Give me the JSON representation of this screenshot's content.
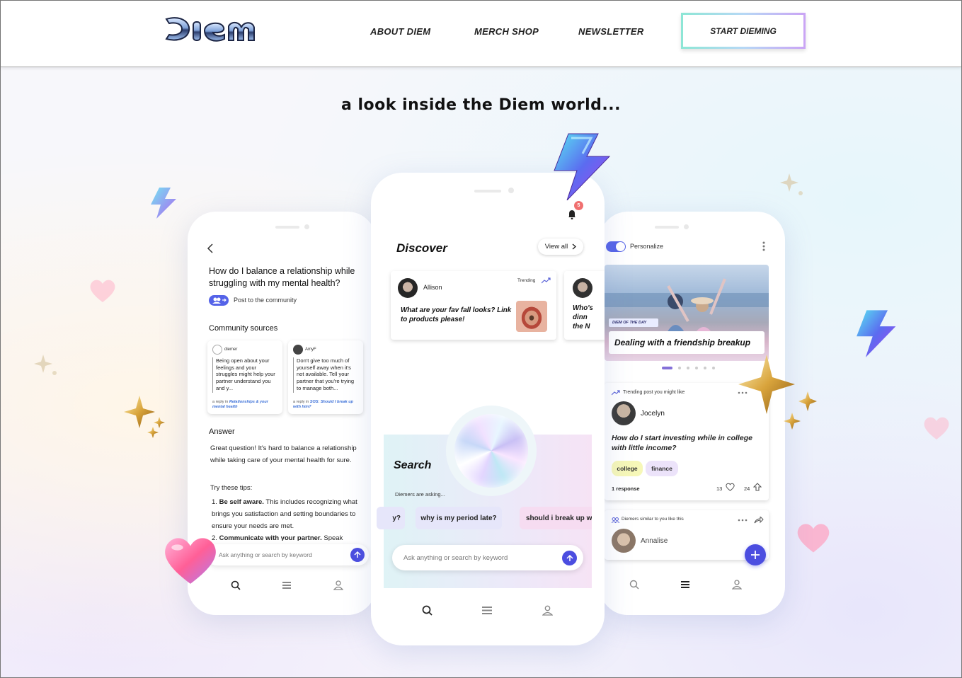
{
  "header": {
    "logo_text": "DIEM",
    "nav": [
      "ABOUT DIEM",
      "MERCH SHOP",
      "NEWSLETTER"
    ],
    "cta": "START DIEMING"
  },
  "headline": "a look inside the Diem world...",
  "left_phone": {
    "question": "How do I balance a relationship while struggling with my mental health?",
    "post_label": "Post to the community",
    "sources_title": "Community sources",
    "sources": [
      {
        "user": "diemer",
        "text": "Being open about your feelings and your struggles might help your partner understand you and y...",
        "reply_prefix": "a reply in ",
        "reply_link": "Relationships & your mental health"
      },
      {
        "user": "AmyF",
        "text": "Don't give too much of yourself away when it's not available. Tell your partner that you're trying to manage both...",
        "reply_prefix": "a reply in ",
        "reply_link": "SOS: Should I break up with him?"
      }
    ],
    "answer_title": "Answer",
    "answer_p1": "Great question! It's hard to balance a relationship while taking care of your mental health for sure.",
    "tips_intro": "Try these tips:",
    "tip1_num": "1.",
    "tip1_bold": "Be self aware.",
    "tip1_text": " This includes recognizing what brings you satisfaction and setting boundaries to ensure your needs are met.",
    "tip2_num": "2.",
    "tip2_bold": "Communicate with your partner.",
    "tip2_text": " Speak",
    "search_placeholder": "Ask anything or search by keyword"
  },
  "center_phone": {
    "notifications": "5",
    "discover_title": "Discover",
    "view_all": "View all",
    "card1": {
      "user": "Allison",
      "badge": "Trending",
      "question": "What are your fav fall looks? Link to products please!"
    },
    "card2_partial": "Who's dinn the N",
    "search_title": "Search",
    "asking_label": "Diemers are asking...",
    "chips": [
      "y?",
      "why is my period late?",
      "should i break up w"
    ],
    "search_placeholder": "Ask anything or search by keyword"
  },
  "right_phone": {
    "personalize": "Personalize",
    "diem_badge": "DIEM OF THE DAY",
    "hero_title": "Dealing with a friendship breakup",
    "trending_label": "Trending post you might like",
    "user": "Jocelyn",
    "question": "How do I start investing while in college with little income?",
    "tags": [
      "college",
      "finance"
    ],
    "responses": "1 response",
    "likes": "13",
    "upvotes": "24",
    "similar_label": "Diemers similar to you like this",
    "similar_user": "Annalise"
  },
  "colors": {
    "accent": "#4b4de0",
    "tag_yellow": "#f6f7b8",
    "tag_purple": "#ece3fa",
    "link": "#3a6fd8",
    "trend": "#5a63d8"
  }
}
